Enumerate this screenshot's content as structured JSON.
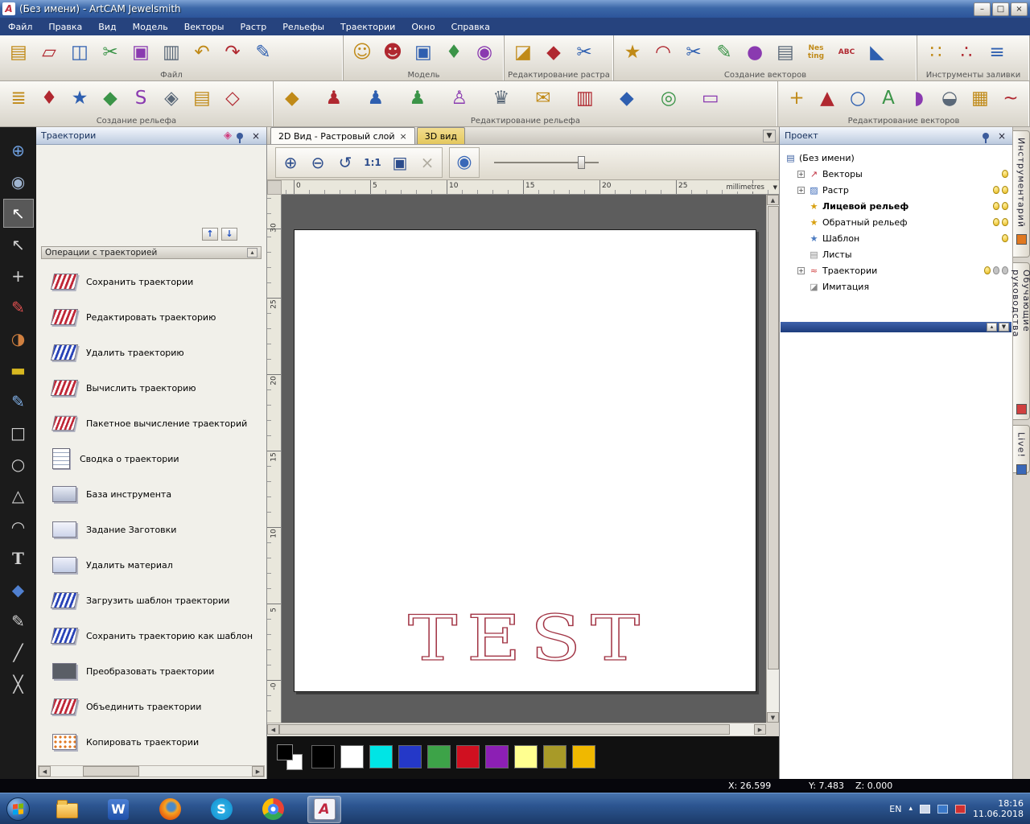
{
  "window": {
    "title": "(Без имени) - ArtCAM Jewelsmith"
  },
  "glyphs": {
    "logo": "A",
    "min": "–",
    "max": "□",
    "close": "×",
    "expand": "+",
    "collapse": "▴",
    "up": "↑",
    "down": "↓",
    "dropdown": "▼",
    "left": "◀",
    "right": "▶",
    "scroll_up": "▲",
    "scroll_down": "▼",
    "zoom_in": "⊕",
    "zoom_out": "⊖",
    "zoom_undo": "↺",
    "ratio": "1:1",
    "fit": "▣",
    "sphere": "◉",
    "diamond": "◈",
    "tray_up": "▴"
  },
  "menu": [
    "Файл",
    "Правка",
    "Вид",
    "Модель",
    "Векторы",
    "Растр",
    "Рельефы",
    "Траектории",
    "Окно",
    "Справка"
  ],
  "toolbars": {
    "row1": {
      "file": {
        "label": "Файл",
        "icons": [
          {
            "n": "new-model-icon",
            "g": "▤"
          },
          {
            "n": "open-model-icon",
            "g": "▱"
          },
          {
            "n": "save-model-icon",
            "g": "◫"
          },
          {
            "n": "cut-icon",
            "g": "✂"
          },
          {
            "n": "copy-icon",
            "g": "▣"
          },
          {
            "n": "paste-icon",
            "g": "▥"
          },
          {
            "n": "undo-icon",
            "g": "↶"
          },
          {
            "n": "redo-icon",
            "g": "↷"
          },
          {
            "n": "notes-icon",
            "g": "✎"
          }
        ]
      },
      "model": {
        "label": "Модель",
        "icons": [
          {
            "n": "model-front-icon",
            "g": "☺"
          },
          {
            "n": "model-back-icon",
            "g": "☻"
          },
          {
            "n": "model-preview-icon",
            "g": "▣"
          },
          {
            "n": "model-tool-icon",
            "g": "♦"
          },
          {
            "n": "model-sphere-icon",
            "g": "◉"
          }
        ]
      },
      "raster": {
        "label": "Редактирование растра",
        "icons": [
          {
            "n": "shape-editor-icon",
            "g": "◪"
          },
          {
            "n": "polygon-edit-icon",
            "g": "◆"
          },
          {
            "n": "crop-raster-icon",
            "g": "✂"
          }
        ]
      },
      "vectors": {
        "label": "Создание векторов",
        "icons": [
          {
            "n": "star-vector-icon",
            "g": "★"
          },
          {
            "n": "arc-vector-icon",
            "g": "◠"
          },
          {
            "n": "trim-vectors-icon",
            "g": "✂"
          },
          {
            "n": "freehand-vector-icon",
            "g": "✎"
          },
          {
            "n": "blob-vector-icon",
            "g": "●"
          },
          {
            "n": "offset-vector-icon",
            "g": "▤"
          },
          {
            "n": "nesting-icon",
            "g": "Nes ting"
          },
          {
            "n": "vector-texture-icon",
            "g": "ABC"
          },
          {
            "n": "wrap-vector-icon",
            "g": "◣"
          }
        ]
      },
      "fill": {
        "label": "Инструменты заливки",
        "icons": [
          {
            "n": "fill-dots-icon",
            "g": "∷"
          },
          {
            "n": "fill-points-icon",
            "g": "∴"
          },
          {
            "n": "fill-connect-icon",
            "g": "≡"
          }
        ]
      }
    },
    "row2": {
      "relief_create": {
        "label": "Создание рельефа",
        "icons": [
          {
            "n": "relief-layers-icon",
            "g": "≣"
          },
          {
            "n": "relief-shape-icon",
            "g": "♦"
          },
          {
            "n": "relief-star-icon",
            "g": "★"
          },
          {
            "n": "relief-extrude-icon",
            "g": "◆"
          },
          {
            "n": "relief-sweep-icon",
            "g": "S"
          },
          {
            "n": "relief-weave-icon",
            "g": "◈"
          },
          {
            "n": "relief-stack-icon",
            "g": "▤"
          },
          {
            "n": "relief-burst-icon",
            "g": "◇"
          }
        ]
      },
      "relief_edit": {
        "label": "Редактирование рельефа",
        "icons": [
          {
            "n": "smooth-relief-icon",
            "g": "◆"
          },
          {
            "n": "spin-relief-icon",
            "g": "♟"
          },
          {
            "n": "spin-relief-2-icon",
            "g": "♟"
          },
          {
            "n": "spin-relief-3-icon",
            "g": "♟"
          },
          {
            "n": "gray-relief-icon",
            "g": "♙"
          },
          {
            "n": "crown-relief-icon",
            "g": "♛"
          },
          {
            "n": "envelope-relief-icon",
            "g": "✉"
          },
          {
            "n": "column-relief-icon",
            "g": "▥"
          },
          {
            "n": "offset-relief-icon",
            "g": "◆"
          },
          {
            "n": "target-relief-icon",
            "g": "◎"
          },
          {
            "n": "erase-relief-icon",
            "g": "▭"
          }
        ]
      },
      "vector_edit": {
        "label": "Редактирование векторов",
        "icons": [
          {
            "n": "add-vector-icon",
            "g": "+"
          },
          {
            "n": "cone-vector-icon",
            "g": "▲"
          },
          {
            "n": "ring-vector-icon",
            "g": "○"
          },
          {
            "n": "letters-vector-icon",
            "g": "A"
          },
          {
            "n": "half-vector-icon",
            "g": "◗"
          },
          {
            "n": "moon-vector-icon",
            "g": "◒"
          },
          {
            "n": "grid-vector-icon",
            "g": "▦"
          },
          {
            "n": "curve-vector-icon",
            "g": "~"
          }
        ]
      }
    }
  },
  "left_tools": [
    {
      "n": "zoom-tool-icon",
      "g": "⊕"
    },
    {
      "n": "view-globe-tool-icon",
      "g": "◉"
    },
    {
      "n": "select-tool-icon",
      "g": "↖"
    },
    {
      "n": "node-edit-tool-icon",
      "g": "↖"
    },
    {
      "n": "transform-tool-icon",
      "g": "+"
    },
    {
      "n": "paint-tool-icon",
      "g": "✎"
    },
    {
      "n": "color-fill-tool-icon",
      "g": "◑"
    },
    {
      "n": "measure-tool-icon",
      "g": "▬"
    },
    {
      "n": "polyline-tool-icon",
      "g": "✎"
    },
    {
      "n": "rectangle-tool-icon",
      "g": "□"
    },
    {
      "n": "ellipse-tool-icon",
      "g": "○"
    },
    {
      "n": "polygon-tool-icon",
      "g": "△"
    },
    {
      "n": "arc-tool-icon",
      "g": "◠"
    },
    {
      "n": "text-tool-icon",
      "g": "T"
    },
    {
      "n": "droplet-tool-icon",
      "g": "◆"
    },
    {
      "n": "sculpt-tool-icon",
      "g": "✎"
    },
    {
      "n": "brush-tool-icon",
      "g": "╱"
    },
    {
      "n": "knife-tool-icon",
      "g": "╳"
    }
  ],
  "toolpaths": {
    "title": "Траектории",
    "section": "Операции с траекторией",
    "items": [
      {
        "n": "save-toolpaths-icon",
        "label": "Сохранить траектории"
      },
      {
        "n": "edit-toolpath-icon",
        "label": "Редактировать траекторию"
      },
      {
        "n": "delete-toolpath-icon",
        "label": "Удалить траекторию"
      },
      {
        "n": "calculate-toolpath-icon",
        "label": "Вычислить траекторию"
      },
      {
        "n": "batch-calculate-icon",
        "label": "Пакетное вычисление траекторий"
      },
      {
        "n": "toolpath-summary-icon",
        "label": "Сводка о траектории"
      },
      {
        "n": "tool-database-icon",
        "label": "База инструмента"
      },
      {
        "n": "material-setup-icon",
        "label": "Задание Заготовки"
      },
      {
        "n": "delete-material-icon",
        "label": "Удалить материал"
      },
      {
        "n": "load-template-icon",
        "label": "Загрузить шаблон траектории"
      },
      {
        "n": "save-as-template-icon",
        "label": "Сохранить траекторию как шаблон"
      },
      {
        "n": "transform-toolpaths-icon",
        "label": "Преобразовать траектории"
      },
      {
        "n": "merge-toolpaths-icon",
        "label": "Объединить траектории"
      },
      {
        "n": "copy-toolpaths-icon",
        "label": "Копировать траектории"
      }
    ]
  },
  "view": {
    "tab2d": "2D Вид - Растровый слой",
    "tab3d": "3D вид",
    "units": "millimetres",
    "h_ticks": [
      "0",
      "5",
      "10",
      "15",
      "20",
      "25"
    ],
    "v_ticks": [
      "30",
      "25",
      "20",
      "15",
      "10",
      "5",
      "-0"
    ],
    "canvas_text": "TEST"
  },
  "project": {
    "title": "Проект",
    "root": "(Без имени)",
    "root_icon": "▤",
    "nodes": [
      {
        "label": "Векторы",
        "icon": "↗"
      },
      {
        "label": "Растр",
        "icon": "▨"
      },
      {
        "label": "Лицевой рельеф",
        "icon": "★"
      },
      {
        "label": "Обратный рельеф",
        "icon": "★"
      },
      {
        "label": "Шаблон",
        "icon": "★"
      },
      {
        "label": "Листы",
        "icon": "▤"
      },
      {
        "label": "Траектории",
        "icon": "≈"
      },
      {
        "label": "Имитация",
        "icon": "◪"
      }
    ]
  },
  "right_tabs": [
    "Инструментарий",
    "Обучающие руководства",
    "Live!"
  ],
  "palette": {
    "colors": [
      "#000000",
      "#ffffff",
      "#00e5e5",
      "#2438c8",
      "#3da348",
      "#d01020",
      "#8c1fb4",
      "#ffff90",
      "#a89a28",
      "#f0b800"
    ]
  },
  "status": {
    "x": "X: 26.599",
    "y": "Y: 7.483",
    "z": "Z: 0.000"
  },
  "taskbar": {
    "lang": "EN",
    "time": "18:16",
    "date": "11.06.2018",
    "word": "W",
    "skype": "S",
    "artcam": "A"
  }
}
